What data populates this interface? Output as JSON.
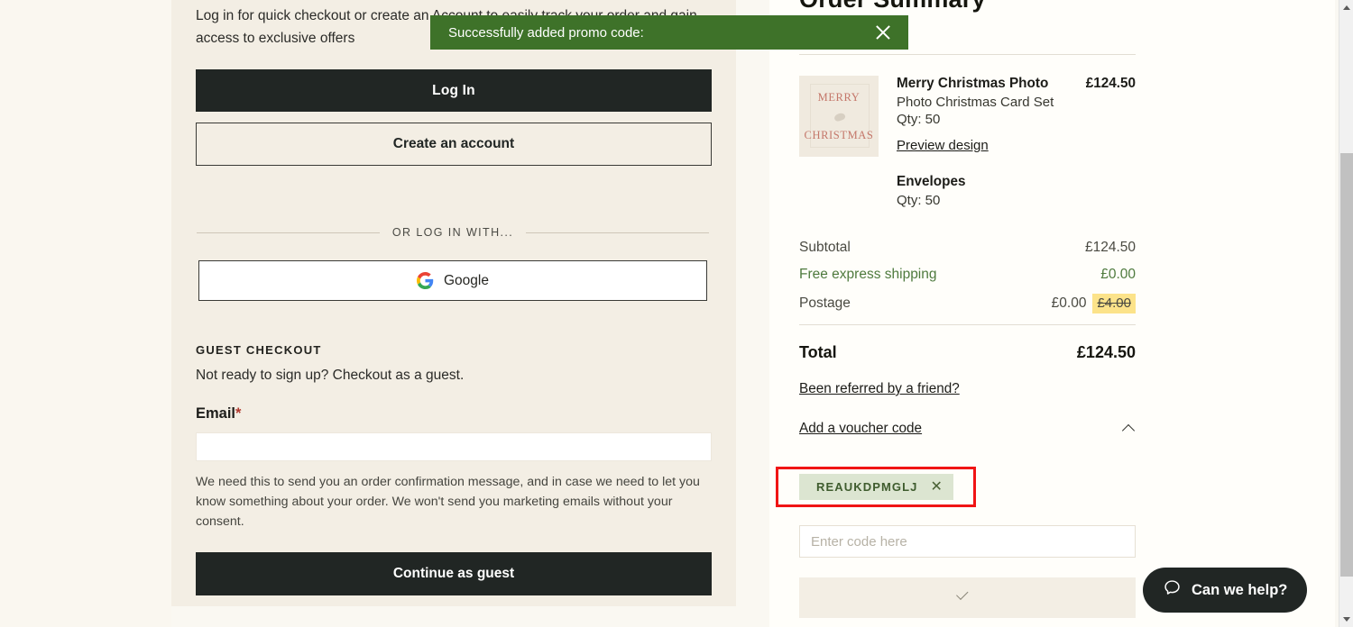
{
  "toast": {
    "message": "Successfully added promo code:",
    "close_icon": "close-icon",
    "color": "#3E7229"
  },
  "login_panel": {
    "intro": "Log in for quick checkout or create an Account to easily track your order and gain access to exclusive offers",
    "login_button": "Log In",
    "create_account_button": "Create an account",
    "divider_label": "OR LOG IN WITH...",
    "google_button": "Google",
    "google_icon": "google-g-icon",
    "guest_heading": "GUEST CHECKOUT",
    "guest_sub": "Not ready to sign up? Checkout as a guest.",
    "email_label": "Email",
    "email_required_marker": "*",
    "email_value": "",
    "email_placeholder": "",
    "email_help": "We need this to send you an order confirmation message, and in case we need to let you know something about your order. We won't send you marketing emails without your consent.",
    "continue_button": "Continue as guest"
  },
  "summary": {
    "title": "Order Summary",
    "item": {
      "name": "Merry Christmas Photo",
      "price": "£124.50",
      "description": "Photo Christmas Card Set",
      "qty": "Qty: 50",
      "preview_link": "Preview design",
      "thumb_top_text": "MERRY",
      "thumb_bottom_text": "CHRISTMAS"
    },
    "sub_item": {
      "name": "Envelopes",
      "qty": "Qty: 50"
    },
    "totals": [
      {
        "label": "Subtotal",
        "value": "£124.50",
        "green": false
      },
      {
        "label": "Free express shipping",
        "value": "£0.00",
        "green": true
      }
    ],
    "postage": {
      "label": "Postage",
      "value": "£0.00",
      "struck_value": "£4.00",
      "highlight_color": "#FCE38A"
    },
    "grand_total": {
      "label": "Total",
      "value": "£124.50"
    },
    "referred_link": "Been referred by a friend?",
    "voucher_toggle": {
      "label": "Add a voucher code",
      "icon": "chevron-up-icon"
    },
    "voucher_chip": {
      "code": "REAUKDPMGLJ",
      "remove_icon": "close-icon",
      "highlight_border_color": "#F01414"
    },
    "code_input": {
      "value": "",
      "placeholder": "Enter code here"
    },
    "apply_button": {
      "label": "",
      "icon": "check-icon"
    }
  },
  "chat": {
    "label": "Can we help?",
    "icon": "chat-bubble-icon"
  },
  "scrollbar": {
    "up_icon": "scroll-up-arrow-icon",
    "down_icon": "scroll-down-arrow-icon"
  }
}
